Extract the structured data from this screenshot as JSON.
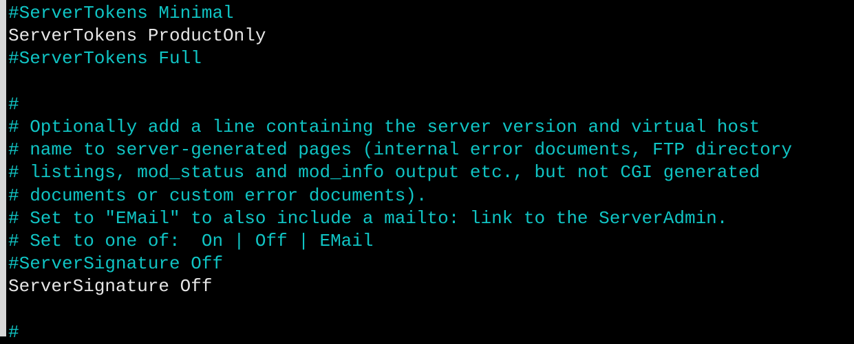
{
  "colors": {
    "background": "#000000",
    "comment": "#10c4c4",
    "text": "#e6e6e6"
  },
  "lines": [
    {
      "text": "#ServerTokens Minimal",
      "type": "comment"
    },
    {
      "text": "ServerTokens ProductOnly",
      "type": "plain"
    },
    {
      "text": "#ServerTokens Full",
      "type": "comment"
    },
    {
      "text": "",
      "type": "plain"
    },
    {
      "text": "#",
      "type": "comment"
    },
    {
      "text": "# Optionally add a line containing the server version and virtual host",
      "type": "comment"
    },
    {
      "text": "# name to server-generated pages (internal error documents, FTP directory",
      "type": "comment"
    },
    {
      "text": "# listings, mod_status and mod_info output etc., but not CGI generated",
      "type": "comment"
    },
    {
      "text": "# documents or custom error documents).",
      "type": "comment"
    },
    {
      "text": "# Set to \"EMail\" to also include a mailto: link to the ServerAdmin.",
      "type": "comment"
    },
    {
      "text": "# Set to one of:  On | Off | EMail",
      "type": "comment"
    },
    {
      "text": "#ServerSignature Off",
      "type": "comment"
    },
    {
      "text": "ServerSignature Off",
      "type": "plain"
    },
    {
      "text": "",
      "type": "plain"
    },
    {
      "text": "#",
      "type": "comment"
    }
  ]
}
